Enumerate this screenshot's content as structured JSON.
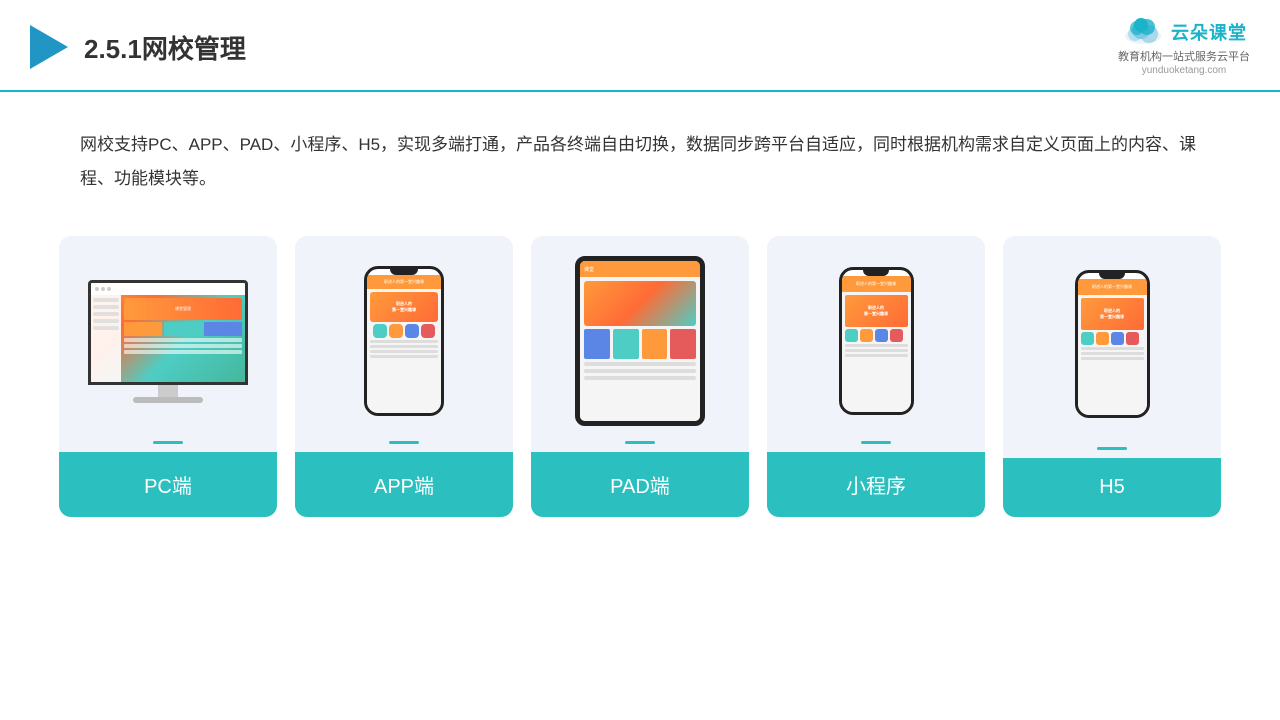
{
  "header": {
    "title": "2.5.1网校管理",
    "logo_brand": "云朵课堂",
    "logo_url": "yunduoketang.com",
    "logo_tagline": "教育机构一站\n式服务云平台"
  },
  "description": {
    "text": "网校支持PC、APP、PAD、小程序、H5，实现多端打通，产品各终端自由切换，数据同步跨平台自适应，同时根据机构需求自定义页面上的内容、课程、功能模块等。"
  },
  "cards": [
    {
      "id": "pc",
      "label": "PC端"
    },
    {
      "id": "app",
      "label": "APP端"
    },
    {
      "id": "pad",
      "label": "PAD端"
    },
    {
      "id": "miniapp",
      "label": "小程序"
    },
    {
      "id": "h5",
      "label": "H5"
    }
  ],
  "colors": {
    "accent": "#2bbfbf",
    "border": "#1ab3c8",
    "title": "#333333",
    "card_bg": "#f0f4fa"
  }
}
